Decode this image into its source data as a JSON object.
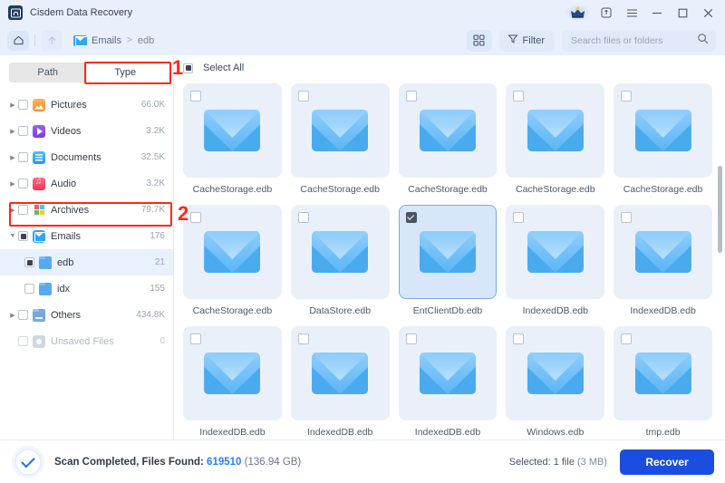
{
  "window": {
    "title": "Cisdem Data Recovery",
    "logo_icon": "app-logo-icon",
    "crown_icon": "crown-premium-icon",
    "upgrade_icon": "upgrade-icon",
    "menu_icon": "hamburger-menu-icon",
    "minimize_icon": "minimize-icon",
    "maximize_icon": "maximize-icon",
    "close_icon": "close-icon"
  },
  "toolbar": {
    "home_icon": "home-icon",
    "up_icon": "arrow-up-icon",
    "breadcrumb": {
      "root": "Emails",
      "separator": ">",
      "current": "edb",
      "icon": "mail-folder-icon"
    },
    "grid_view_icon": "grid-view-icon",
    "filter_label": "Filter",
    "filter_icon": "filter-funnel-icon",
    "search_placeholder": "Search files or folders",
    "search_value": "",
    "search_icon": "search-icon"
  },
  "sidebar": {
    "tabs": [
      {
        "label": "Path",
        "active": false
      },
      {
        "label": "Type",
        "active": true
      }
    ],
    "items": [
      {
        "label": "Pictures",
        "count": "66.0K",
        "icon": "pictures-icon",
        "icon_class": "ic-pic",
        "expandable": true,
        "checkbox": "unchecked",
        "child": false,
        "selected": false,
        "disabled": false
      },
      {
        "label": "Videos",
        "count": "3.2K",
        "icon": "videos-icon",
        "icon_class": "ic-vid",
        "expandable": true,
        "checkbox": "unchecked",
        "child": false,
        "selected": false,
        "disabled": false
      },
      {
        "label": "Documents",
        "count": "32.5K",
        "icon": "documents-icon",
        "icon_class": "ic-doc",
        "expandable": true,
        "checkbox": "unchecked",
        "child": false,
        "selected": false,
        "disabled": false
      },
      {
        "label": "Audio",
        "count": "3.2K",
        "icon": "audio-icon",
        "icon_class": "ic-aud",
        "expandable": true,
        "checkbox": "unchecked",
        "child": false,
        "selected": false,
        "disabled": false
      },
      {
        "label": "Archives",
        "count": "79.7K",
        "icon": "archives-icon",
        "icon_class": "ic-arc",
        "expandable": true,
        "checkbox": "unchecked",
        "child": false,
        "selected": false,
        "disabled": false
      },
      {
        "label": "Emails",
        "count": "176",
        "icon": "emails-icon",
        "icon_class": "ic-mail",
        "expandable": true,
        "expanded": true,
        "checkbox": "indeterminate",
        "child": false,
        "selected": false,
        "disabled": false
      },
      {
        "label": "edb",
        "count": "21",
        "icon": "folder-icon",
        "icon_class": "ic-fold",
        "expandable": false,
        "checkbox": "indeterminate",
        "child": true,
        "selected": true,
        "disabled": false
      },
      {
        "label": "idx",
        "count": "155",
        "icon": "folder-icon",
        "icon_class": "ic-fold",
        "expandable": false,
        "checkbox": "unchecked",
        "child": true,
        "selected": false,
        "disabled": false
      },
      {
        "label": "Others",
        "count": "434.8K",
        "icon": "others-folder-icon",
        "icon_class": "ic-oth",
        "expandable": true,
        "checkbox": "unchecked",
        "child": false,
        "selected": false,
        "disabled": false
      },
      {
        "label": "Unsaved Files",
        "count": "0",
        "icon": "unsaved-files-icon",
        "icon_class": "ic-uns",
        "expandable": false,
        "checkbox": "unchecked",
        "child": false,
        "selected": false,
        "disabled": true
      }
    ]
  },
  "main": {
    "select_all_label": "Select All",
    "select_all_state": "indeterminate",
    "files": [
      {
        "name": "CacheStorage.edb",
        "checked": false,
        "icon": "email-file-icon"
      },
      {
        "name": "CacheStorage.edb",
        "checked": false,
        "icon": "email-file-icon"
      },
      {
        "name": "CacheStorage.edb",
        "checked": false,
        "icon": "email-file-icon"
      },
      {
        "name": "CacheStorage.edb",
        "checked": false,
        "icon": "email-file-icon"
      },
      {
        "name": "CacheStorage.edb",
        "checked": false,
        "icon": "email-file-icon"
      },
      {
        "name": "CacheStorage.edb",
        "checked": false,
        "icon": "email-file-icon"
      },
      {
        "name": "DataStore.edb",
        "checked": false,
        "icon": "email-file-icon"
      },
      {
        "name": "EntClientDb.edb",
        "checked": true,
        "icon": "email-file-icon"
      },
      {
        "name": "IndexedDB.edb",
        "checked": false,
        "icon": "email-file-icon"
      },
      {
        "name": "IndexedDB.edb",
        "checked": false,
        "icon": "email-file-icon"
      },
      {
        "name": "IndexedDB.edb",
        "checked": false,
        "icon": "email-file-icon"
      },
      {
        "name": "IndexedDB.edb",
        "checked": false,
        "icon": "email-file-icon"
      },
      {
        "name": "IndexedDB.edb",
        "checked": false,
        "icon": "email-file-icon"
      },
      {
        "name": "Windows.edb",
        "checked": false,
        "icon": "email-file-icon"
      },
      {
        "name": "tmp.edb",
        "checked": false,
        "icon": "email-file-icon"
      }
    ]
  },
  "footer": {
    "status_icon": "scan-complete-check-icon",
    "status_prefix": "Scan Completed, Files Found: ",
    "files_found": "619510",
    "total_size": " (136.94 GB)",
    "selected_label": "Selected: 1 file ",
    "selected_size": "(3 MB)",
    "recover_label": "Recover"
  },
  "annotations": [
    {
      "number": "1",
      "target": "type-tab"
    },
    {
      "number": "2",
      "target": "sidebar-item-emails"
    }
  ],
  "colors": {
    "accent": "#1b4ee0",
    "link": "#2b7cf0",
    "annotation": "#fb2a10",
    "titlebar_bg": "#e9f0fb",
    "tile_bg": "#eaf0fa",
    "tile_selected_bg": "#d8e6fb"
  }
}
